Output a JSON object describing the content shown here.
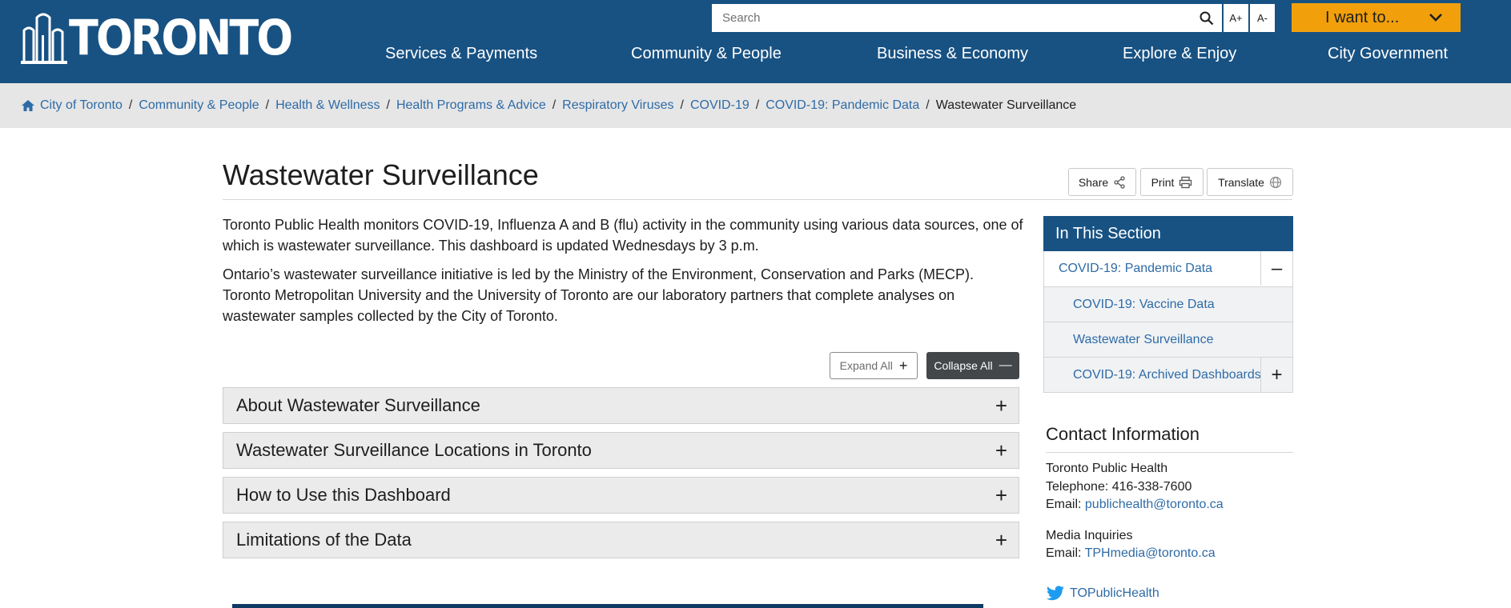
{
  "header": {
    "logo_text": "TORONTO",
    "search_placeholder": "Search",
    "font_increase": "A+",
    "font_decrease": "A-",
    "i_want_to": "I want to...",
    "nav": [
      "Services & Payments",
      "Community & People",
      "Business & Economy",
      "Explore & Enjoy",
      "City Government"
    ]
  },
  "breadcrumb": {
    "links": [
      "City of Toronto",
      "Community & People",
      "Health & Wellness",
      "Health Programs & Advice",
      "Respiratory Viruses",
      "COVID-19",
      "COVID-19: Pandemic Data"
    ],
    "current": "Wastewater Surveillance"
  },
  "page": {
    "title": "Wastewater Surveillance",
    "tools": {
      "share": "Share",
      "print": "Print",
      "translate": "Translate"
    },
    "intro": [
      "Toronto Public Health monitors COVID-19, Influenza A and B (flu) activity in the community using various data sources, one of which is wastewater surveillance. This dashboard is updated Wednesdays by 3 p.m.",
      "Ontario’s wastewater surveillance initiative is led by the Ministry of the Environment, Conservation and Parks (MECP). Toronto Metropolitan University and the University of Toronto are our laboratory partners that complete analyses on wastewater samples collected by the City of Toronto."
    ],
    "expand_all": "Expand All",
    "collapse_all": "Collapse All",
    "accordions": [
      "About Wastewater Surveillance",
      "Wastewater Surveillance Locations in Toronto",
      "How to Use this Dashboard",
      "Limitations of the Data"
    ]
  },
  "sidebar": {
    "section_title": "In This Section",
    "parent": "COVID-19: Pandemic Data",
    "children": [
      "COVID-19: Vaccine Data",
      "Wastewater Surveillance",
      "COVID-19: Archived Dashboards"
    ],
    "contact": {
      "title": "Contact Information",
      "org": "Toronto Public Health",
      "telephone": "Telephone: 416-338-7600",
      "email_label": "Email: ",
      "email": "publichealth@toronto.ca",
      "media_label": "Media Inquiries",
      "media_email_label": "Email: ",
      "media_email": "TPHmedia@toronto.ca",
      "twitter": "TOPublicHealth"
    }
  },
  "colors": {
    "header_blue": "#185283",
    "accent_orange": "#f1a00b",
    "link_blue": "#2f6ba6"
  }
}
